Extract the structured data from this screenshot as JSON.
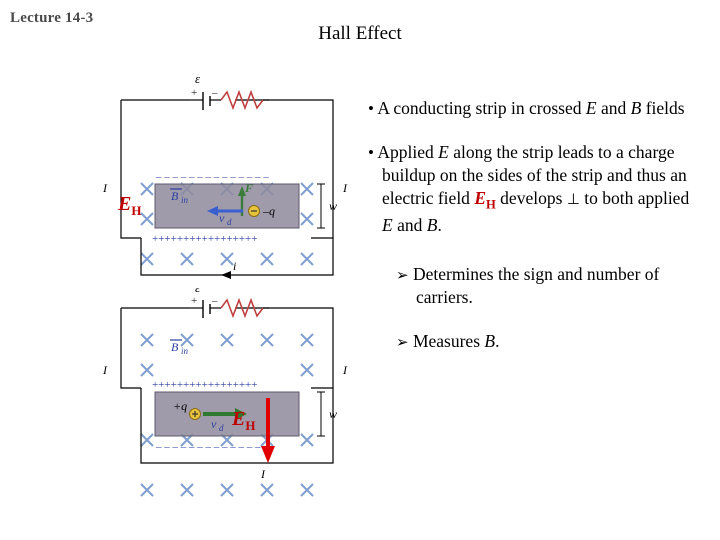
{
  "header": {
    "lecture": "Lecture 14-3",
    "title": "Hall Effect"
  },
  "body": {
    "bullets": [
      {
        "marker": "•",
        "segments": [
          {
            "text": "A conducting strip in crossed ",
            "style": "plain"
          },
          {
            "text": "E",
            "style": "italic"
          },
          {
            "text": " and ",
            "style": "plain"
          },
          {
            "text": "B",
            "style": "italic"
          },
          {
            "text": " fields",
            "style": "plain"
          }
        ],
        "plain": "• A conducting strip in crossed E and B fields"
      },
      {
        "marker": "•",
        "plain": "• Applied E along the strip leads to a charge buildup on the sides of the strip and thus an electric field EH develops ⊥ to both applied E and B."
      }
    ],
    "arrow_items": [
      {
        "marker": "Ø",
        "plain": "Determines the sign and number of carriers."
      },
      {
        "marker": "Ø",
        "plain": "Measures B."
      }
    ]
  },
  "figures": {
    "top": {
      "name": "negative-carriers-diagram",
      "field_label": "B_in",
      "current_left": "I",
      "current_right": "I",
      "current_bottom": "i",
      "width_label": "w",
      "force_label": "F",
      "drift_label": "v_d",
      "charge_label": "−q",
      "hall_field_label": "E",
      "hall_field_sub": "H",
      "top_charge_row": "− − − − − − − − − − − −",
      "bottom_charge_row": "+++++++++++++++++",
      "battery_label": "ε"
    },
    "bottom": {
      "name": "positive-carriers-diagram",
      "field_label": "B_in",
      "current_left": "I",
      "current_right": "I",
      "current_bottom": "I",
      "width_label": "w",
      "drift_label": "v_d",
      "charge_label": "+q",
      "hall_field_label": "E",
      "hall_field_sub": "H",
      "top_charge_row": "+++++++++++++++++",
      "bottom_charge_row": "− − − − − − − − − − − −",
      "battery_label": "ε"
    }
  },
  "colors": {
    "hall_field_red": "#c00000",
    "field_cross_blue": "#7e9fd0",
    "slab_gray": "#8e8a9c",
    "force_green": "#3a7d3a",
    "lecture_gray": "#4a4a4a"
  }
}
